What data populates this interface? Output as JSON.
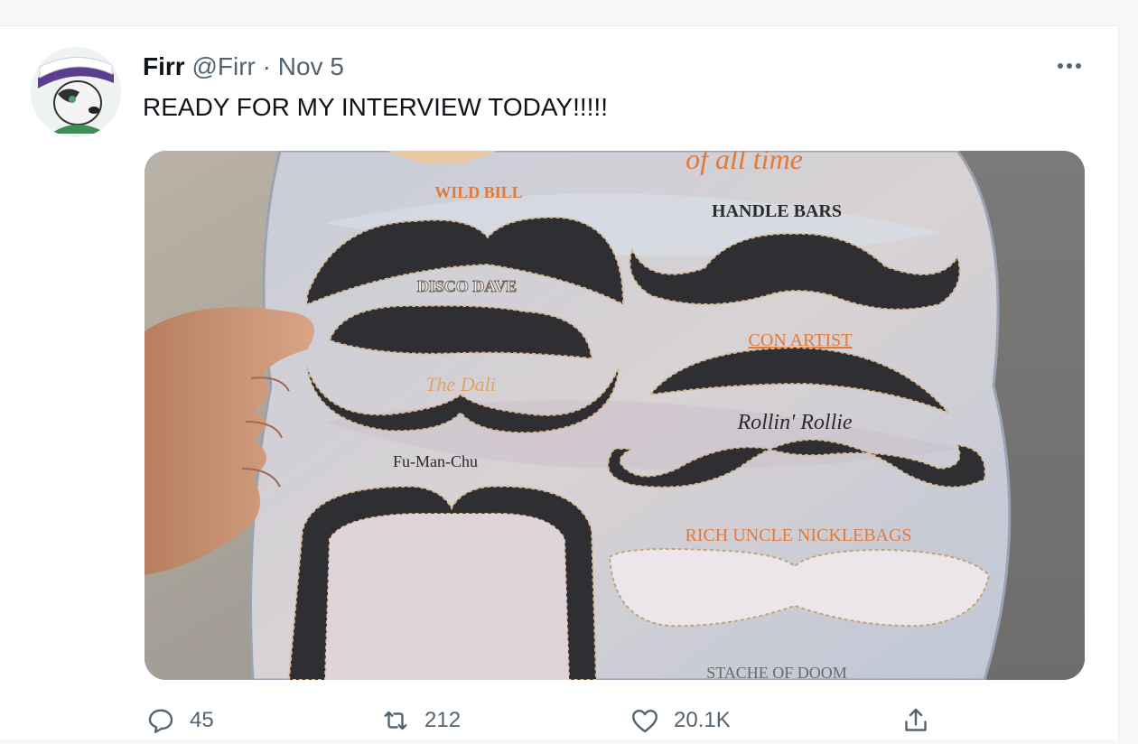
{
  "tweet": {
    "author_name": "Firr",
    "author_handle": "@Firr",
    "separator": "·",
    "date": "Nov 5",
    "text": "READY FOR MY INTERVIEW TODAY!!!!!"
  },
  "media": {
    "header_script": "of all time",
    "labels": {
      "wild_bill": "WILD BILL",
      "handle_bars": "HANDLE BARS",
      "disco_dave": "DISCO DAVE",
      "con_artist": "CON ARTIST",
      "the_dali": "The Dali",
      "rollin_rollie": "Rollin' Rollie",
      "fu_man_chu": "Fu-Man-Chu",
      "rich_uncle": "RICH UNCLE NICKLEBAGS",
      "bottom_cut": "STACHE OF DOOM"
    }
  },
  "actions": {
    "replies": "45",
    "retweets": "212",
    "likes": "20.1K"
  },
  "icons": {
    "reply": "speech-bubble-icon",
    "retweet": "retweet-arrows-icon",
    "like": "heart-icon",
    "share": "share-upload-icon",
    "more": "more-dots-icon"
  },
  "colors": {
    "text_primary": "#0f1419",
    "text_secondary": "#536471",
    "label_orange": "#e07a3a",
    "label_dark": "#2b2b2b"
  }
}
